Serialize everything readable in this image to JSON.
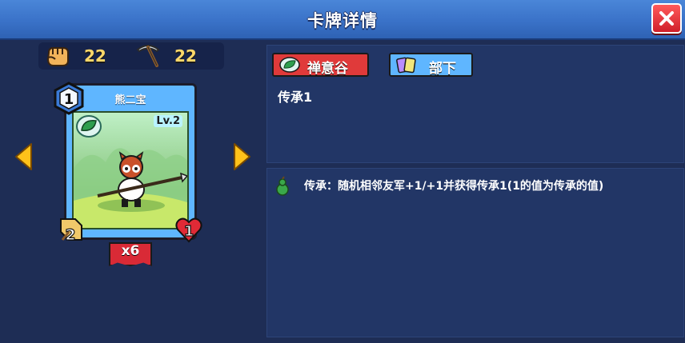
{
  "window": {
    "title": "卡牌详情"
  },
  "stats": [
    {
      "icon": "fist-icon",
      "value": "22"
    },
    {
      "icon": "pickaxe-icon",
      "value": "22"
    }
  ],
  "card": {
    "name": "熊二宝",
    "cost": "1",
    "level": "Lv.2",
    "attack": "2",
    "health": "1",
    "count": "x6",
    "faction_icon": "leaf-icon",
    "frame_color": "#5fb6ff"
  },
  "tags": [
    {
      "label": "禅意谷",
      "icon": "leaf-icon",
      "color": "#e03a3a"
    },
    {
      "label": "部下",
      "icon": "cards-icon",
      "color": "#5fb6ff"
    }
  ],
  "keyword": "传承1",
  "description": {
    "icon": "gourd-icon",
    "text": "传承：随机相邻友军+1/+1并获得传承1(1的值为传承的值)"
  },
  "colors": {
    "title_bar": "#3a72c8",
    "close_button": "#d01f2a",
    "stat_text": "#ffd86a",
    "arrow": "#ffc21a"
  }
}
